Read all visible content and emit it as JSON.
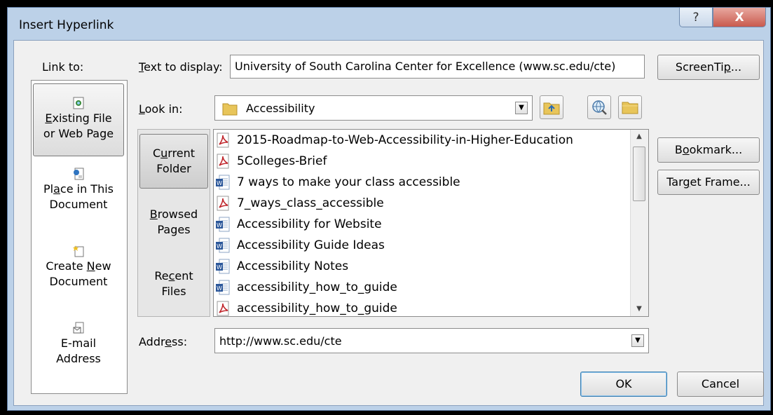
{
  "window": {
    "title": "Insert Hyperlink",
    "help_label": "?",
    "close_label": "X"
  },
  "link_to": {
    "label": "Link to:",
    "items": [
      {
        "line1": "Existing File",
        "line2": "or Web Page",
        "icon": "existing-file-icon",
        "selected": true
      },
      {
        "line1": "Place in This",
        "line2": "Document",
        "icon": "place-in-document-icon"
      },
      {
        "line1": "Create New",
        "line2": "Document",
        "icon": "create-new-document-icon"
      },
      {
        "line1": "E-mail",
        "line2": "Address",
        "icon": "email-address-icon"
      }
    ]
  },
  "text_to_display": {
    "label": "Text to display:",
    "value": "University of South Carolina Center for Excellence (www.sc.edu/cte)"
  },
  "screentip_button": "ScreenTip...",
  "look_in": {
    "label": "Look in:",
    "value": "Accessibility",
    "icon": "folder-icon"
  },
  "toolbar_icons": [
    "up-one-folder-icon",
    "browse-web-icon",
    "browse-file-icon"
  ],
  "nav": {
    "items": [
      {
        "line1": "Current",
        "line2": "Folder",
        "selected": true
      },
      {
        "line1": "Browsed",
        "line2": "Pages"
      },
      {
        "line1": "Recent",
        "line2": "Files"
      }
    ]
  },
  "files": [
    {
      "name": "2015-Roadmap-to-Web-Accessibility-in-Higher-Education",
      "type": "pdf"
    },
    {
      "name": "5Colleges-Brief",
      "type": "pdf"
    },
    {
      "name": "7 ways to make your class accessible",
      "type": "word"
    },
    {
      "name": "7_ways_class_accessible",
      "type": "pdf"
    },
    {
      "name": "Accessibility for Website",
      "type": "word"
    },
    {
      "name": "Accessibility Guide Ideas",
      "type": "word"
    },
    {
      "name": "Accessibility Notes",
      "type": "word"
    },
    {
      "name": "accessibility_how_to_guide",
      "type": "word"
    },
    {
      "name": "accessibility_how_to_guide",
      "type": "pdf"
    }
  ],
  "right_buttons": {
    "bookmark": "Bookmark...",
    "target_frame": "Target Frame..."
  },
  "address": {
    "label": "Address:",
    "value": "http://www.sc.edu/cte"
  },
  "ok_button": "OK",
  "cancel_button": "Cancel",
  "colors": {
    "frame": "#bcd1e8",
    "close": "#c95a4d",
    "pdf_red": "#c0272d",
    "word_blue": "#2b579a"
  }
}
